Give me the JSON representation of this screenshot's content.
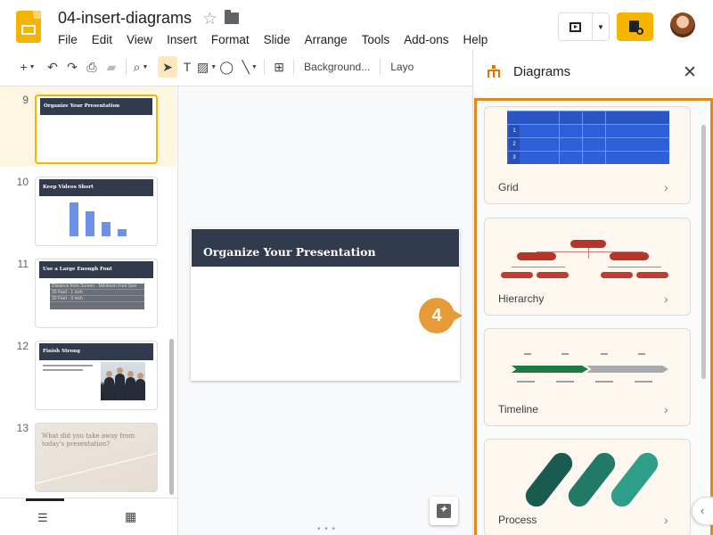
{
  "header": {
    "doc_title": "04-insert-diagrams",
    "menu": [
      "File",
      "Edit",
      "View",
      "Insert",
      "Format",
      "Slide",
      "Arrange",
      "Tools",
      "Add-ons",
      "Help"
    ]
  },
  "toolbar": {
    "background_label": "Background...",
    "layout_label": "Layo"
  },
  "filmstrip": {
    "slides": [
      {
        "num": "9",
        "title": "Organize Your Presentation",
        "selected": true
      },
      {
        "num": "10",
        "title": "Keep Videos Short"
      },
      {
        "num": "11",
        "title": "Use a Large Enough Font",
        "table": [
          [
            "Distance from Screen",
            "Minimum Font Size"
          ],
          [
            "20 Feet",
            "1 inch"
          ],
          [
            "30 Feet",
            "3 inch"
          ]
        ]
      },
      {
        "num": "12",
        "title": "Finish Strong"
      },
      {
        "num": "13",
        "title": "What did you take away from today's presentation?"
      }
    ]
  },
  "canvas": {
    "slide_title": "Organize Your Presentation"
  },
  "panel": {
    "title": "Diagrams",
    "cards": [
      {
        "label": "Grid"
      },
      {
        "label": "Hierarchy"
      },
      {
        "label": "Timeline"
      },
      {
        "label": "Process"
      }
    ]
  },
  "callout": {
    "number": "4"
  },
  "colors": {
    "accent": "#f4b400",
    "slide_header": "#323a4d",
    "highlight": "#e08a1e",
    "grid_blue": "#2f5fd8",
    "hierarchy_red": "#b8332a",
    "timeline_green": "#1e7a45",
    "process_teal": "#1f7f72"
  }
}
